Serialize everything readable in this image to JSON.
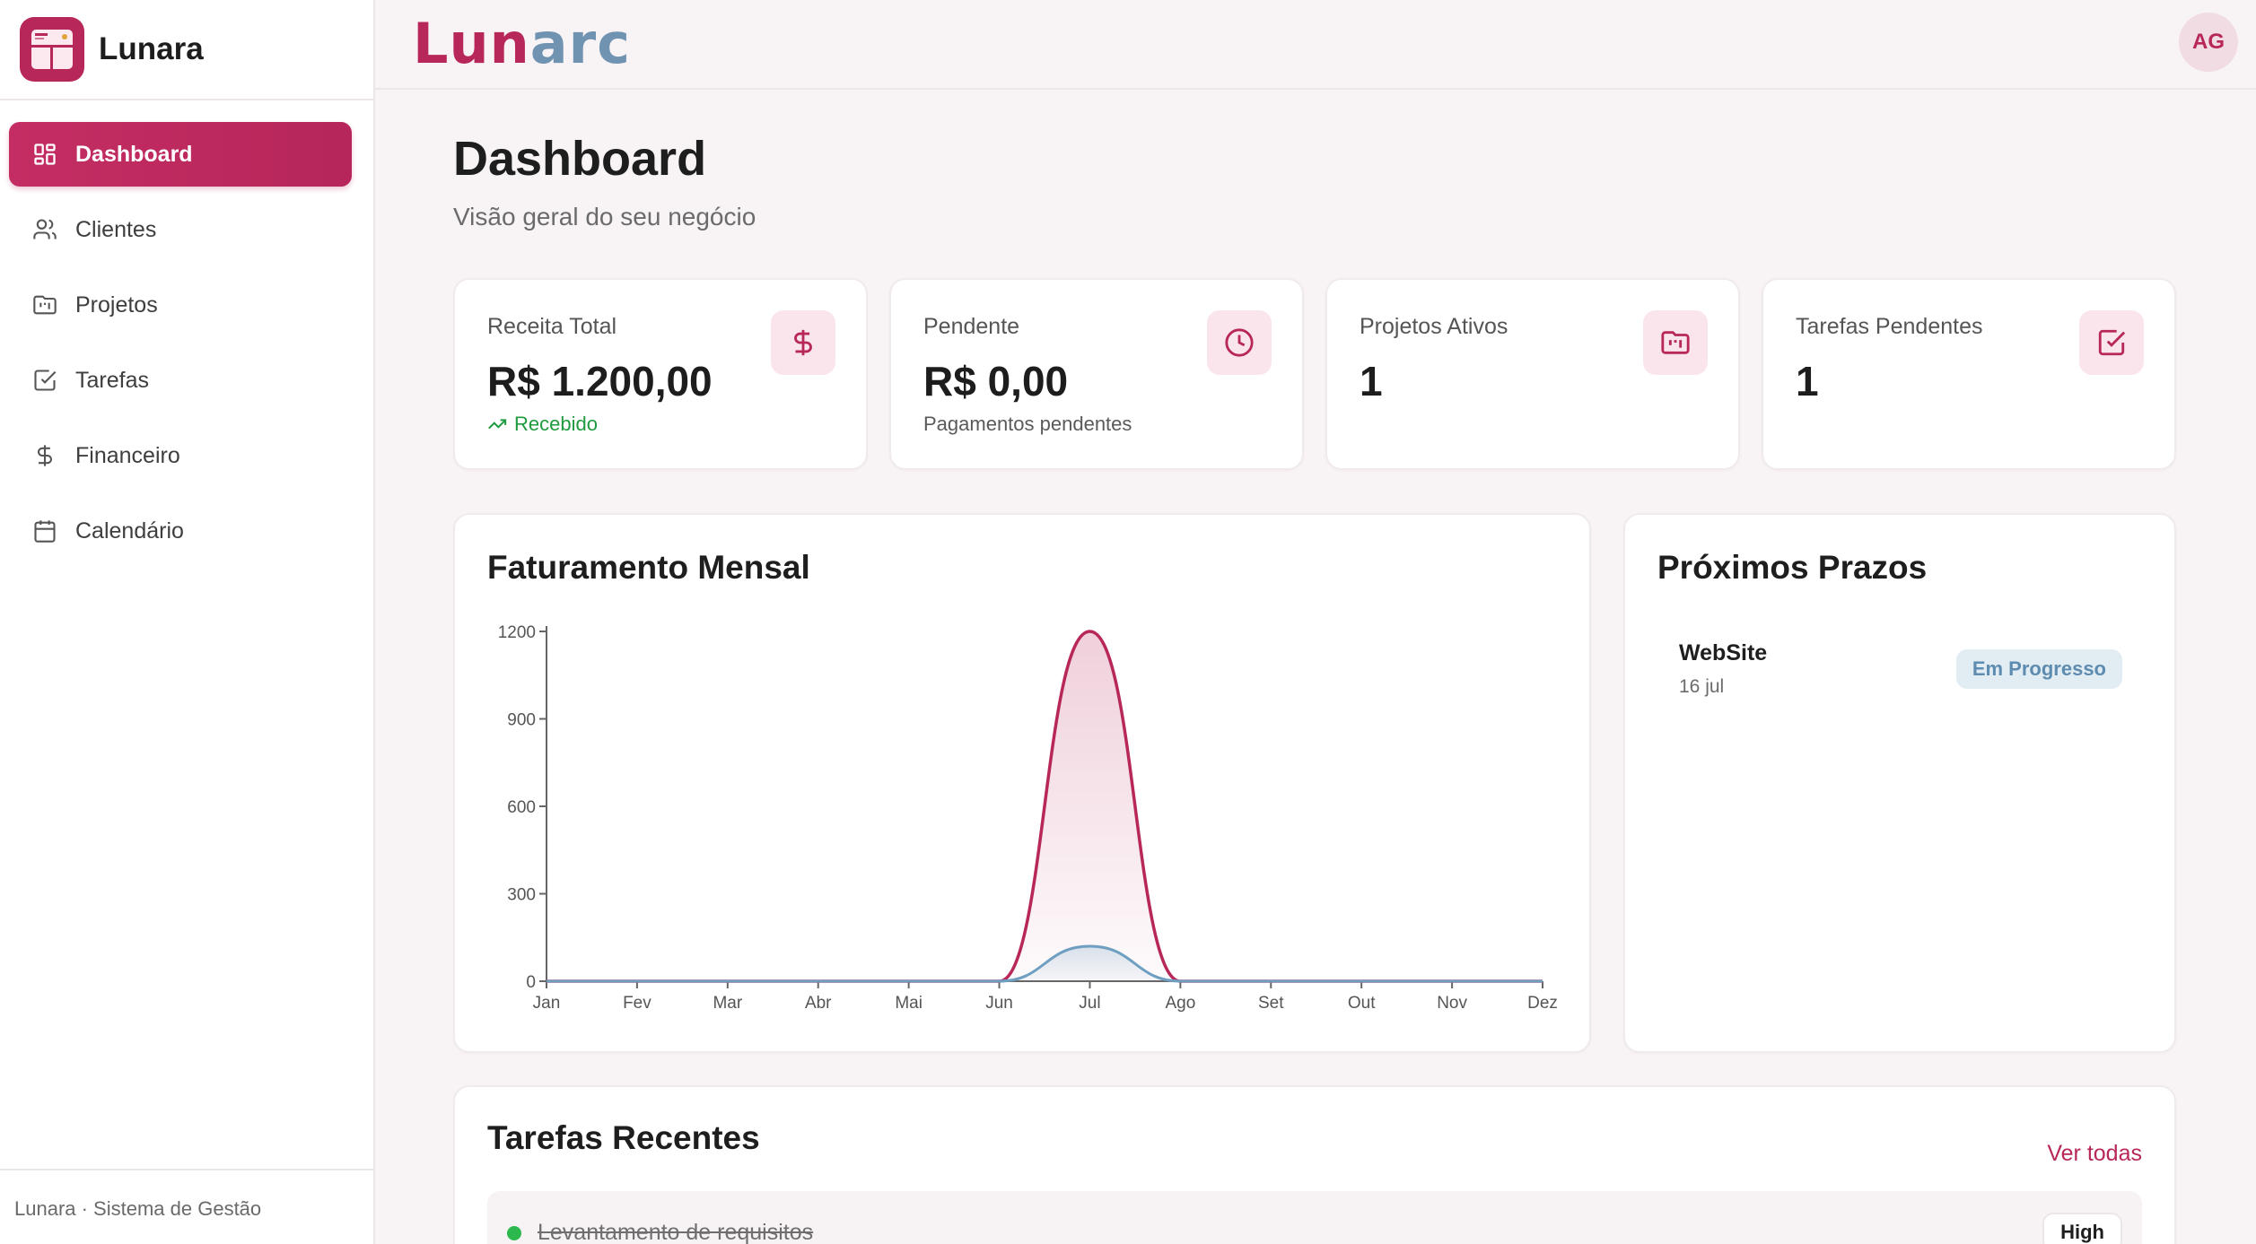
{
  "sidebar": {
    "brand": "Lunara",
    "items": [
      {
        "label": "Dashboard",
        "icon": "dashboard-icon",
        "active": true
      },
      {
        "label": "Clientes",
        "icon": "users-icon"
      },
      {
        "label": "Projetos",
        "icon": "folder-kanban-icon"
      },
      {
        "label": "Tarefas",
        "icon": "check-square-icon"
      },
      {
        "label": "Financeiro",
        "icon": "dollar-icon"
      },
      {
        "label": "Calendário",
        "icon": "calendar-icon"
      }
    ],
    "footer": "Lunara · Sistema de Gestão"
  },
  "header": {
    "wordmark_part1": "Lun",
    "wordmark_part2": "arc",
    "avatar_initials": "AG"
  },
  "page": {
    "title": "Dashboard",
    "subtitle": "Visão geral do seu negócio"
  },
  "stats": [
    {
      "label": "Receita Total",
      "value": "R$ 1.200,00",
      "note": "Recebido",
      "icon": "dollar-icon"
    },
    {
      "label": "Pendente",
      "value": "R$ 0,00",
      "note": "Pagamentos pendentes",
      "icon": "clock-icon"
    },
    {
      "label": "Projetos Ativos",
      "value": "1",
      "note": "",
      "icon": "folder-kanban-icon"
    },
    {
      "label": "Tarefas Pendentes",
      "value": "1",
      "note": "",
      "icon": "check-square-icon"
    }
  ],
  "revenue_chart": {
    "title": "Faturamento Mensal"
  },
  "chart_data": {
    "type": "area",
    "title": "Faturamento Mensal",
    "categories": [
      "Jan",
      "Fev",
      "Mar",
      "Abr",
      "Mai",
      "Jun",
      "Jul",
      "Ago",
      "Set",
      "Out",
      "Nov",
      "Dez"
    ],
    "y_ticks": [
      0,
      300,
      600,
      900,
      1200
    ],
    "ylim": [
      0,
      1200
    ],
    "series": [
      {
        "values": [
          0,
          0,
          0,
          0,
          0,
          0,
          1200,
          0,
          0,
          0,
          0,
          0
        ],
        "color": "#b8275a"
      },
      {
        "values": [
          0,
          0,
          0,
          0,
          0,
          0,
          120,
          0,
          0,
          0,
          0,
          0
        ],
        "color": "#6f9fc0"
      }
    ],
    "grid": false,
    "legend": "none"
  },
  "deadlines": {
    "title": "Próximos Prazos",
    "items": [
      {
        "name": "WebSite",
        "date": "16 jul",
        "status": "Em Progresso"
      }
    ]
  },
  "recent_tasks": {
    "title": "Tarefas Recentes",
    "view_all": "Ver todas",
    "items": [
      {
        "name": "Levantamento de requisitos",
        "priority": "High",
        "done": true
      }
    ]
  },
  "colors": {
    "accent": "#b8275a",
    "secondary": "#6f9fc0",
    "success": "#2db84d",
    "background": "#f8f3f5"
  }
}
